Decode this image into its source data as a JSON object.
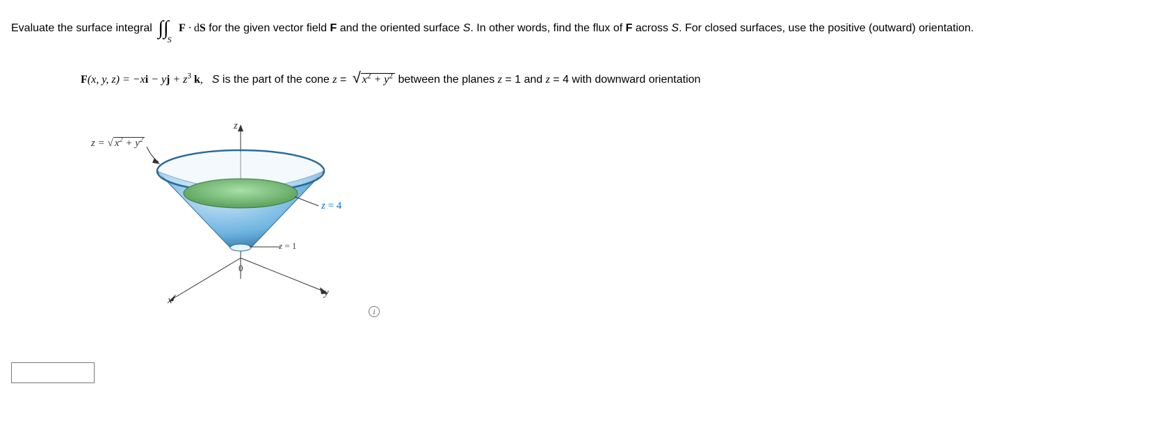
{
  "problem": {
    "intro_part1": "Evaluate the surface integral ",
    "integral_expr": "F · dS",
    "intro_part2": " for the given vector field F and the oriented surface S. In other words, find the flux of F across S. For closed surfaces, use the positive (outward) orientation.",
    "field_def_lhs": "F(x, y, z) = ",
    "field_def_rhs": "−xi − yj + z³k,",
    "surface_part1": "   S is the part of the cone z = ",
    "sqrt_body": "x² + y²",
    "surface_part2": " between the planes z = 1 and z = 4 with downward orientation"
  },
  "figure": {
    "cone_eq": "z = √(x² + y²)",
    "axis_z": "z",
    "axis_x": "x",
    "axis_y": "y",
    "origin": "0",
    "plane1": "z = 1",
    "plane4": "z = 4"
  },
  "info_icon": "i",
  "answer_value": ""
}
